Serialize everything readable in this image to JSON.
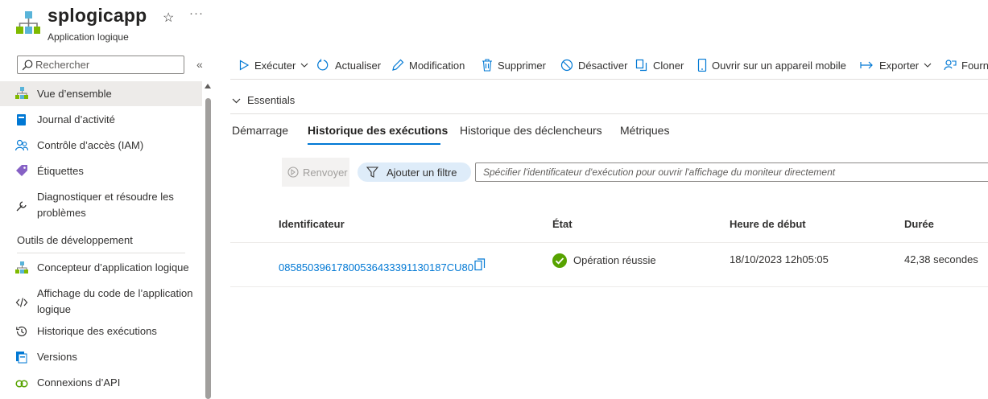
{
  "header": {
    "title": "splogicapp",
    "subtitle": "Application logique",
    "star_icon": "☆",
    "more_icon": "···"
  },
  "sidebar": {
    "search_placeholder": "Rechercher",
    "collapse_icon": "«",
    "items": [
      {
        "label": "Vue d’ensemble",
        "icon": "logic-app-icon"
      },
      {
        "label": "Journal d’activité",
        "icon": "activity-log-icon"
      },
      {
        "label": "Contrôle d’accès (IAM)",
        "icon": "people-icon"
      },
      {
        "label": "Étiquettes",
        "icon": "tag-icon"
      },
      {
        "label": "Diagnostiquer et résoudre les problèmes",
        "icon": "wrench-icon"
      }
    ],
    "section_header": "Outils de développement",
    "dev_items": [
      {
        "label": "Concepteur d’application logique",
        "icon": "designer-icon"
      },
      {
        "label": "Affichage du code de l’application logique",
        "icon": "code-icon"
      },
      {
        "label": "Historique des exécutions",
        "icon": "history-icon"
      },
      {
        "label": "Versions",
        "icon": "versions-icon"
      },
      {
        "label": "Connexions d’API",
        "icon": "api-connections-icon"
      }
    ]
  },
  "toolbar": {
    "run": "Exécuter",
    "refresh": "Actualiser",
    "edit": "Modification",
    "delete": "Supprimer",
    "disable": "Désactiver",
    "clone": "Cloner",
    "open_mobile": "Ouvrir sur un appareil mobile",
    "export": "Exporter",
    "feedback": "Fourn"
  },
  "essentials_label": "Essentials",
  "tabs": [
    "Démarrage",
    "Historique des exécutions",
    "Historique des déclencheurs",
    "Métriques"
  ],
  "actions": {
    "resend": "Renvoyer",
    "add_filter": "Ajouter un filtre",
    "runid_placeholder": "Spécifier l'identificateur d'exécution pour ouvrir l'affichage du moniteur directement"
  },
  "table": {
    "headers": [
      "Identificateur",
      "État",
      "Heure de début",
      "Durée"
    ],
    "rows": [
      {
        "id": "08585039617800536433391130187CU80",
        "status": "Opération réussie",
        "start": "18/10/2023 12h05:05",
        "duration": "42,38 secondes"
      }
    ]
  },
  "colors": {
    "accent": "#0078d4",
    "success": "#57a300",
    "nav_active_bg": "#edebe9",
    "filter_bg": "#deecf9"
  }
}
